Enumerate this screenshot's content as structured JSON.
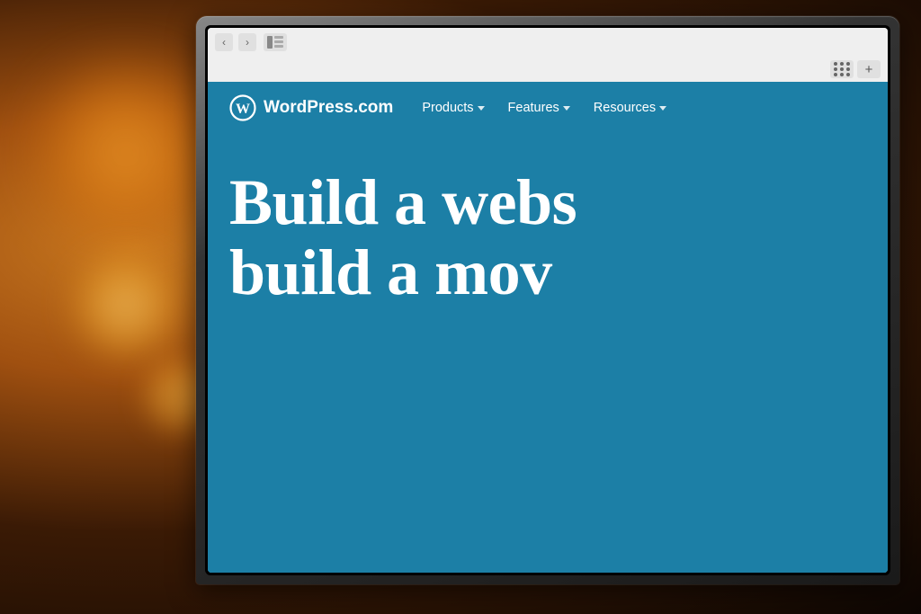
{
  "background": {
    "description": "Blurred bokeh warm background with orange/amber lights"
  },
  "browser": {
    "back_label": "‹",
    "forward_label": "›",
    "back_disabled": true,
    "forward_disabled": false
  },
  "wordpress": {
    "logo_symbol": "W",
    "site_name": "WordPress.com",
    "nav_items": [
      {
        "label": "Products",
        "has_dropdown": true
      },
      {
        "label": "Features",
        "has_dropdown": true
      },
      {
        "label": "Resources",
        "has_dropdown": true
      }
    ],
    "hero_line1": "Build a webs",
    "hero_line2": "build a mov"
  }
}
